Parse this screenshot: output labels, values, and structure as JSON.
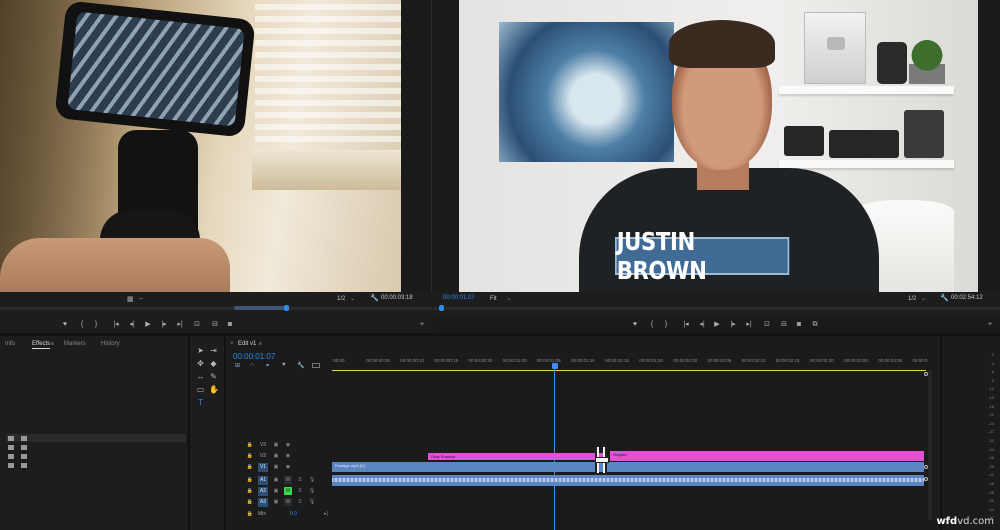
{
  "source_monitor": {
    "zoom": "1/2",
    "duration": "00:00:03:18"
  },
  "program_monitor": {
    "timecode": "00:00:01:07",
    "fit": "Fit",
    "zoom": "1/2",
    "duration": "00:02:54:12",
    "lower_third_text": "JUSTIN BROWN"
  },
  "effects_panel": {
    "tabs": [
      "Info",
      "Effects",
      "Markers",
      "History"
    ],
    "active_tab": "Effects"
  },
  "timeline": {
    "sequence_name": "Edit v1",
    "timecode": "00:00:01:07",
    "ruler_labels": [
      ":00:00",
      "00:00:00:05",
      "00:00:00:10",
      "00:00:00:15",
      "00:00:00:20",
      "00:00:01:00",
      "00:00:01:05",
      "00:00:01:10",
      "00:00:01:15",
      "00:00:01:20",
      "00:00:02:00",
      "00:00:02:05",
      "00:00:02:10",
      "00:00:02:15",
      "00:00:02:20",
      "00:00:03:00",
      "00:00:03:05",
      "00:00:0"
    ],
    "tracks": {
      "video": [
        "V3",
        "V2",
        "V1"
      ],
      "audio": [
        "A1",
        "A2",
        "A3"
      ],
      "master": "Mix",
      "master_value": "0.0"
    },
    "clips": {
      "v2_adjust": "Drop Shadow",
      "v2_graphic": "Graphic",
      "v1_footage": "Footage.mp4 [V]"
    }
  },
  "audio_meter_labels": [
    "0",
    "-3",
    "-6",
    "-9",
    "-12",
    "-15",
    "-18",
    "-21",
    "-24",
    "-27",
    "-30",
    "-33",
    "-36",
    "-39",
    "-42",
    "-45",
    "-48",
    "-51",
    "-54",
    "-57"
  ],
  "watermark": {
    "brand": "wfd",
    "domain": "vd.com"
  },
  "colors": {
    "accent": "#2d8ceb",
    "graphic_clip": "#e34fd8",
    "footage_clip": "#5b85c4",
    "lower_third": "#3f6b95",
    "solo_active": "#3fd64a"
  }
}
